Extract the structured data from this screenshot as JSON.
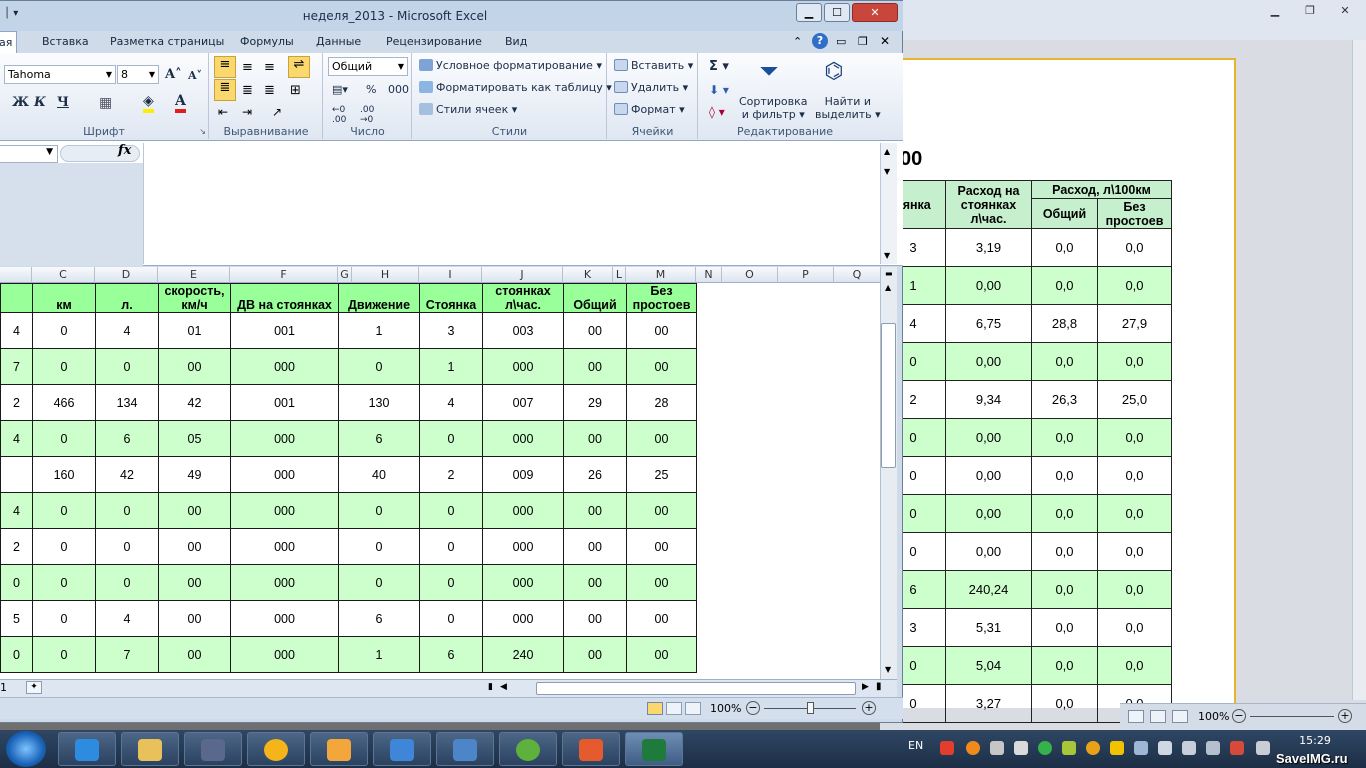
{
  "window": {
    "title": "неделя_2013 - Microsoft Excel"
  },
  "tabs": [
    "ая",
    "Вставка",
    "Разметка страницы",
    "Формулы",
    "Данные",
    "Рецензирование",
    "Вид"
  ],
  "ribbon": {
    "font": {
      "name": "Tahoma",
      "size": "8",
      "group": "Шрифт"
    },
    "align": {
      "group": "Выравнивание"
    },
    "number": {
      "format": "Общий",
      "group": "Число",
      "percent": "%",
      "thousands": "000"
    },
    "styles": {
      "cond": "Условное форматирование",
      "table": "Форматировать как таблицу",
      "cell": "Стили ячеек",
      "group": "Стили"
    },
    "cells": {
      "insert": "Вставить",
      "delete": "Удалить",
      "format": "Формат",
      "group": "Ячейки"
    },
    "edit": {
      "sort1": "Сортировка",
      "sort2": "и фильтр",
      "find1": "Найти и",
      "find2": "выделить",
      "group": "Редактирование"
    }
  },
  "formula": {
    "fx": "fx"
  },
  "columns": [
    "C",
    "D",
    "E",
    "F",
    "G",
    "H",
    "I",
    "J",
    "K",
    "L",
    "M",
    "N",
    "O",
    "P",
    "Q"
  ],
  "header": [
    "",
    "км",
    "л.",
    "скорость, км/ч",
    "ДВ на стоянках",
    "Движение",
    "Стоянка",
    "стоянках л\\час.",
    "Общий",
    "Без простоев"
  ],
  "rows": [
    [
      "4",
      "0",
      "4",
      "01",
      "001",
      "1",
      "3",
      "003",
      "00",
      "00"
    ],
    [
      "7",
      "0",
      "0",
      "00",
      "000",
      "0",
      "1",
      "000",
      "00",
      "00"
    ],
    [
      "2",
      "466",
      "134",
      "42",
      "001",
      "130",
      "4",
      "007",
      "29",
      "28"
    ],
    [
      "4",
      "0",
      "6",
      "05",
      "000",
      "6",
      "0",
      "000",
      "00",
      "00"
    ],
    [
      "",
      "160",
      "42",
      "49",
      "000",
      "40",
      "2",
      "009",
      "26",
      "25"
    ],
    [
      "4",
      "0",
      "0",
      "00",
      "000",
      "0",
      "0",
      "000",
      "00",
      "00"
    ],
    [
      "2",
      "0",
      "0",
      "00",
      "000",
      "0",
      "0",
      "000",
      "00",
      "00"
    ],
    [
      "0",
      "0",
      "0",
      "00",
      "000",
      "0",
      "0",
      "000",
      "00",
      "00"
    ],
    [
      "5",
      "0",
      "4",
      "00",
      "000",
      "6",
      "0",
      "000",
      "00",
      "00"
    ],
    [
      "0",
      "0",
      "7",
      "00",
      "000",
      "1",
      "6",
      "240",
      "00",
      "00"
    ]
  ],
  "sheet_tab": "1",
  "status": {
    "zoom": "100%"
  },
  "bg": {
    "title": "00",
    "h_a": "рянка",
    "h_b": "Расход на стоянках л\\час.",
    "h_c": "Расход, л\\100км",
    "h_d": "Общий",
    "h_e": "Без простоев",
    "rows": [
      [
        "3",
        "3,19",
        "0,0",
        "0,0"
      ],
      [
        "1",
        "0,00",
        "0,0",
        "0,0"
      ],
      [
        "4",
        "6,75",
        "28,8",
        "27,9"
      ],
      [
        "0",
        "0,00",
        "0,0",
        "0,0"
      ],
      [
        "2",
        "9,34",
        "26,3",
        "25,0"
      ],
      [
        "0",
        "0,00",
        "0,0",
        "0,0"
      ],
      [
        "0",
        "0,00",
        "0,0",
        "0,0"
      ],
      [
        "0",
        "0,00",
        "0,0",
        "0,0"
      ],
      [
        "0",
        "0,00",
        "0,0",
        "0,0"
      ],
      [
        "6",
        "240,24",
        "0,0",
        "0,0"
      ],
      [
        "3",
        "5,31",
        "0,0",
        "0,0"
      ],
      [
        "0",
        "5,04",
        "0,0",
        "0,0"
      ],
      [
        "0",
        "3,27",
        "0,0",
        "0,0"
      ]
    ],
    "zoom": "100%"
  },
  "taskbar": {
    "lang": "EN",
    "time": "15:29"
  },
  "watermark": "SaveIMG.ru"
}
